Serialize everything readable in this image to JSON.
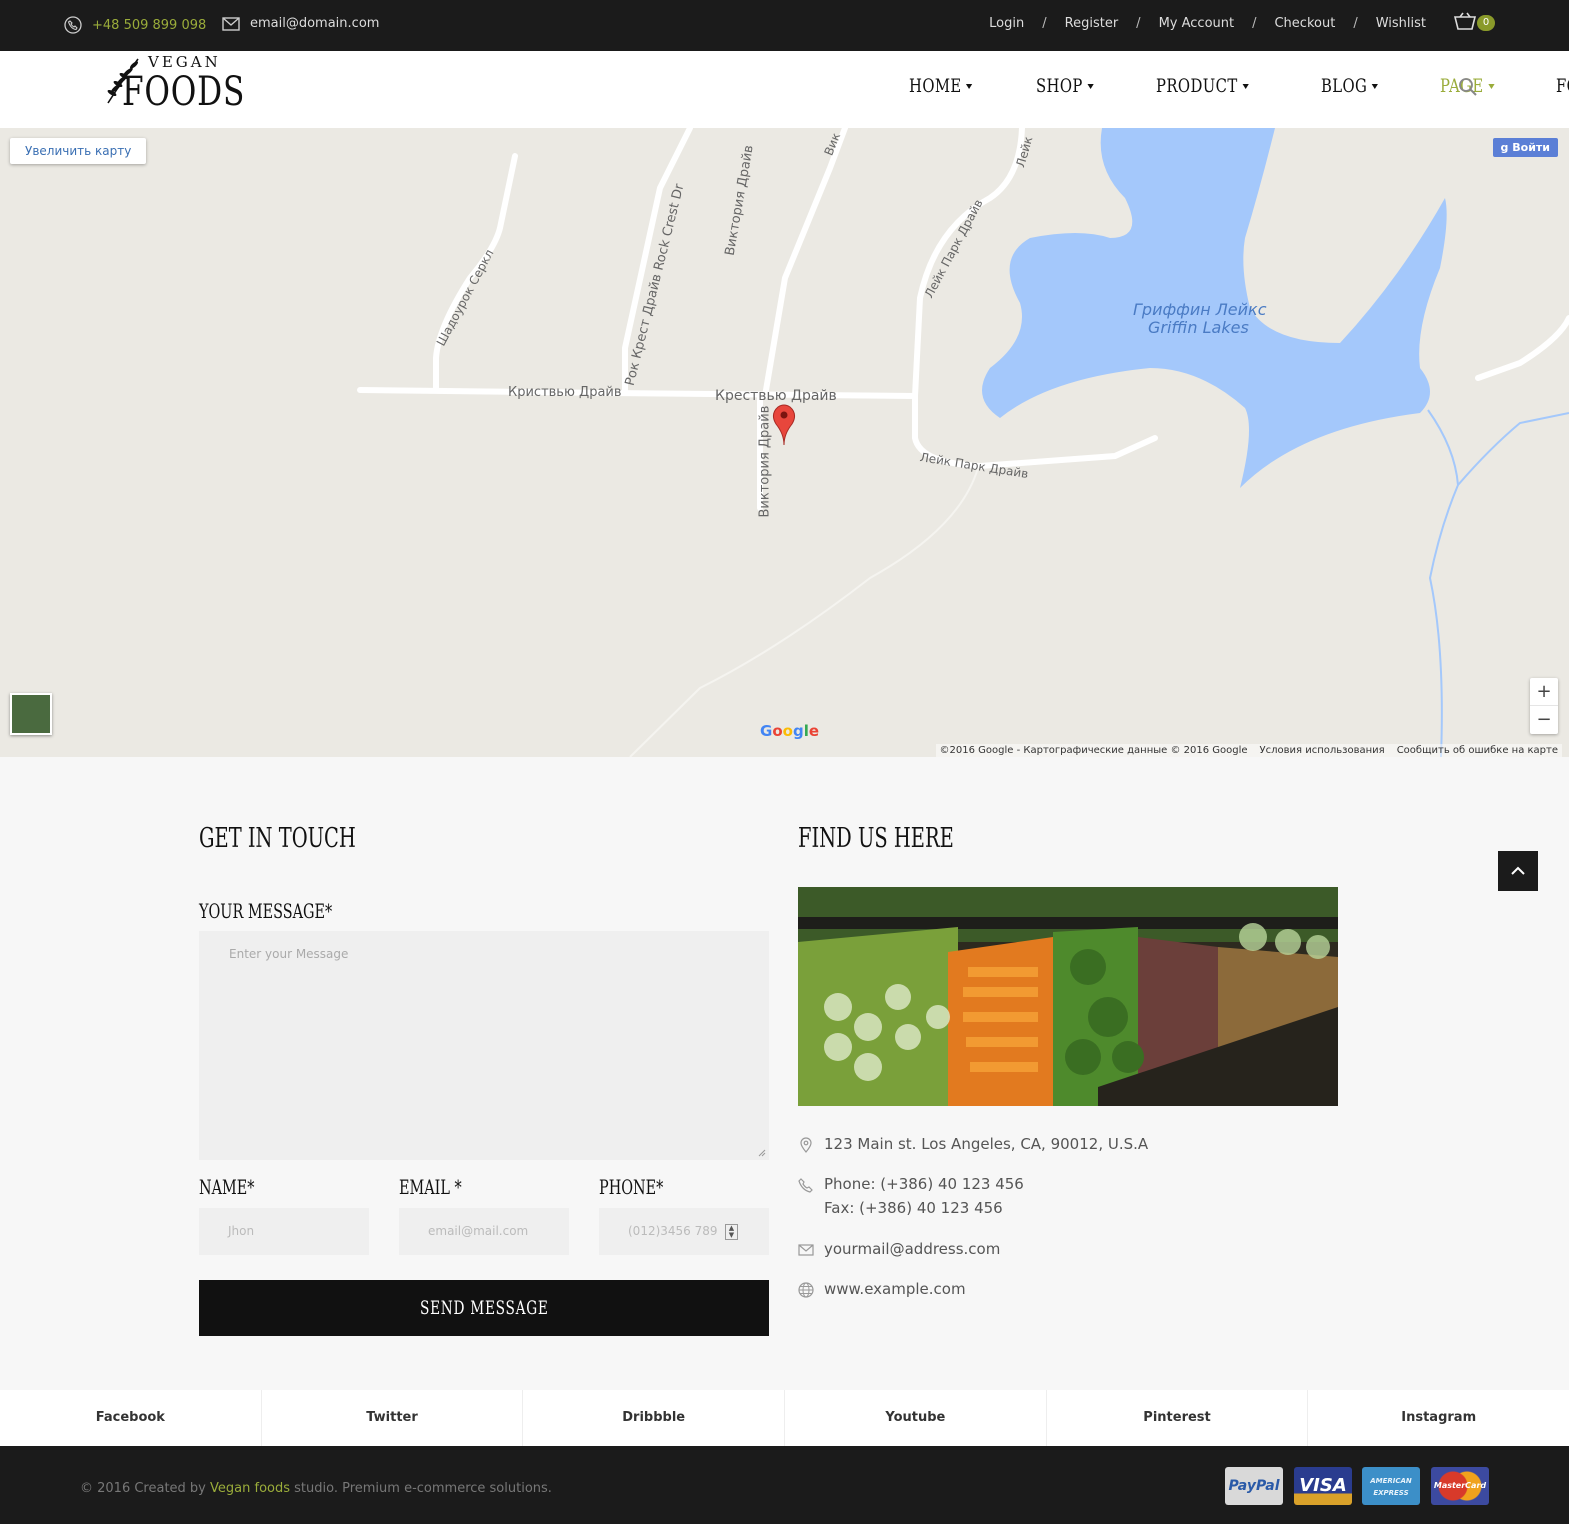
{
  "topbar": {
    "phone": "+48 509 899 098",
    "email": "email@domain.com",
    "links": [
      "Login",
      "Register",
      "My Account",
      "Checkout",
      "Wishlist"
    ],
    "separator": "/",
    "cart_count": "0"
  },
  "header": {
    "logo_top": "VEGAN",
    "logo_main": "FOODS",
    "nav": [
      {
        "label": "HOME",
        "dropdown": true
      },
      {
        "label": "SHOP",
        "dropdown": true
      },
      {
        "label": "PRODUCT",
        "dropdown": true
      },
      {
        "label": "BLOG",
        "dropdown": true
      },
      {
        "label": "PAGE",
        "dropdown": true,
        "active": true
      },
      {
        "label": "FQA",
        "dropdown": false
      }
    ]
  },
  "map": {
    "enlarge_button": "Увеличить карту",
    "login_button": "Войти",
    "street_labels": {
      "crestview_1": "Криствью Драйв",
      "crestview_2": "Крествью Драйв",
      "victoria_1": "Виктория Драйв",
      "victoria_2": "Виктория Драйв",
      "rock_crest": "Рок Крест Драйв Rock Crest Dr",
      "shadowrock": "Шадоурок Серкл",
      "lake_park_1": "Лейк Парк Драйв",
      "lake_park_2": "Лейк Парк Драйв",
      "lake_top": "Лейк",
      "vik_top": "Вик"
    },
    "lake_name_ru": "Гриффин Лейкс",
    "lake_name_en": "Griffin Lakes",
    "google": "Google",
    "attribution": "©2016 Google - Картографические данные © 2016 Google",
    "terms": "Условия использования",
    "report": "Сообщить об ошибке на карте",
    "zoom_in": "+",
    "zoom_out": "−"
  },
  "contact": {
    "form_title": "GET IN TOUCH",
    "message_label": "YOUR MESSAGE*",
    "message_placeholder": "Enter your Message",
    "name_label": "NAME*",
    "name_placeholder": "Jhon",
    "email_label": "EMAIL *",
    "email_placeholder": "email@mail.com",
    "phone_label": "PHONE*",
    "phone_placeholder": "(012)3456 789",
    "send_button": "SEND MESSAGE",
    "find_title": "FIND US HERE",
    "address": "123 Main st. Los Angeles, CA, 90012, U.S.A",
    "phone": "Phone: (+386) 40 123 456",
    "fax": "Fax: (+386) 40 123 456",
    "mail": "yourmail@address.com",
    "web": "www.example.com"
  },
  "social": [
    "Facebook",
    "Twitter",
    "Dribbble",
    "Youtube",
    "Pinterest",
    "Instagram"
  ],
  "footer": {
    "copy_prefix": "© 2016 Created by ",
    "copy_brand": "Vegan foods",
    "copy_suffix": " studio. Premium e-commerce solutions.",
    "payments": [
      "PayPal",
      "VISA",
      "AMERICAN EXPRESS",
      "MasterCard"
    ]
  },
  "colors": {
    "accent": "#9aac3a",
    "dark": "#1b1b1b",
    "lake": "#a4c8fb"
  }
}
